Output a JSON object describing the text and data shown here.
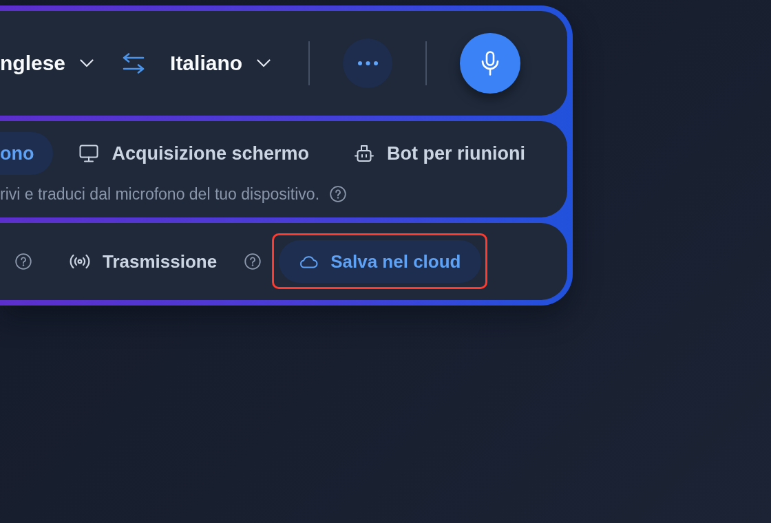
{
  "language_bar": {
    "source_language": "nglese",
    "target_language": "Italiano"
  },
  "source_tabs": {
    "tabs": [
      {
        "kind": "plain",
        "label": "ono",
        "selected": true
      },
      {
        "kind": "screen",
        "label": "Acquisizione schermo",
        "selected": false
      },
      {
        "kind": "bot",
        "label": "Bot per riunioni",
        "selected": false
      }
    ],
    "hint": "rivi e traduci dal microfono del tuo dispositivo."
  },
  "options": [
    {
      "kind": "help"
    },
    {
      "kind": "broadcast",
      "label": "Trasmissione",
      "on": false,
      "highlighted": false
    },
    {
      "kind": "help"
    },
    {
      "kind": "cloud",
      "label": "Salva nel cloud",
      "on": true,
      "highlighted": true
    }
  ]
}
